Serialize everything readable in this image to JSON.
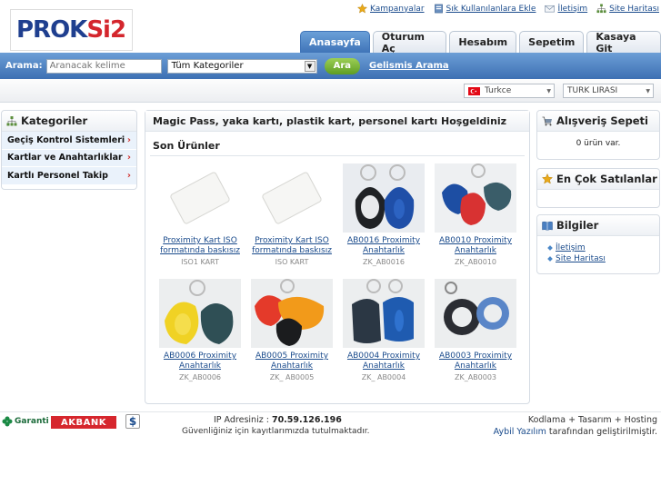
{
  "header": {
    "logo_text_part1": "PROK",
    "logo_text_part2": "Si2",
    "top_links": [
      {
        "label": "Kampanyalar",
        "icon": "star-icon"
      },
      {
        "label": "Sık Kullanılanlara Ekle",
        "icon": "bookmark-icon"
      },
      {
        "label": "İletişim",
        "icon": "mail-icon"
      },
      {
        "label": "Site Haritası",
        "icon": "sitemap-icon"
      }
    ],
    "tabs": [
      "Anasayfa",
      "Oturum Aç",
      "Hesabım",
      "Sepetim",
      "Kasaya Git"
    ]
  },
  "search": {
    "label": "Arama:",
    "placeholder": "Aranacak kelime",
    "category": "Tüm Kategoriler",
    "button": "Ara",
    "advanced": "Gelismis Arama"
  },
  "selectors": {
    "language": "Turkce",
    "currency": "TURK LIRASI"
  },
  "sidebar": {
    "title": "Kategoriler",
    "items": [
      "Geçiş Kontrol Sistemleri",
      "Kartlar ve Anahtarlıklar",
      "Kartlı Personel Takip"
    ]
  },
  "main": {
    "welcome": "Magic Pass, yaka kartı, plastik kart, personel kartı Hoşgeldiniz",
    "section_title": "Son Ürünler",
    "products": [
      {
        "name": "Proximity Kart ISO formatında baskısız",
        "code": "ISO1 KART"
      },
      {
        "name": "Proximity Kart ISO formatında baskısız",
        "code": "ISO KART"
      },
      {
        "name": "AB0016 Proximity Anahtarlık",
        "code": "ZK_AB0016"
      },
      {
        "name": "AB0010 Proximity Anahtarlık",
        "code": "ZK_AB0010"
      },
      {
        "name": "AB0006 Proximity Anahtarlık",
        "code": "ZK_AB0006"
      },
      {
        "name": "AB0005 Proximity Anahtarlık",
        "code": "ZK_ AB0005"
      },
      {
        "name": "AB0004 Proximity Anahtarlık",
        "code": "ZK_ AB0004"
      },
      {
        "name": "AB0003 Proximity Anahtarlık",
        "code": "ZK_AB0003"
      }
    ]
  },
  "right": {
    "cart_title": "Alışveriş Sepeti",
    "cart_text": "0 ürün var.",
    "best_title": "En Çok Satılanlar",
    "info_title": "Bilgiler",
    "info_links": [
      "İletişim",
      "Site Haritası"
    ]
  },
  "footer": {
    "garanti": "Garanti",
    "akbank": "AKBANK",
    "dollar": "$",
    "ip_label": "IP Adresiniz :",
    "ip_value": "70.59.126.196",
    "security_note": "Güvenliğiniz için kayıtlarımızda tutulmaktadır.",
    "credit_line1": "Kodlama + Tasarım + Hosting",
    "credit_link": "Aybil Yazılım",
    "credit_line2_suffix": "tarafından geliştirilmiştir."
  },
  "colors": {
    "nav_blue": "#3f74b8",
    "logo_blue": "#1f3f8f",
    "logo_red": "#d4262d",
    "category_bg": "#eaf2fb",
    "search_green": "#5e9d23"
  }
}
